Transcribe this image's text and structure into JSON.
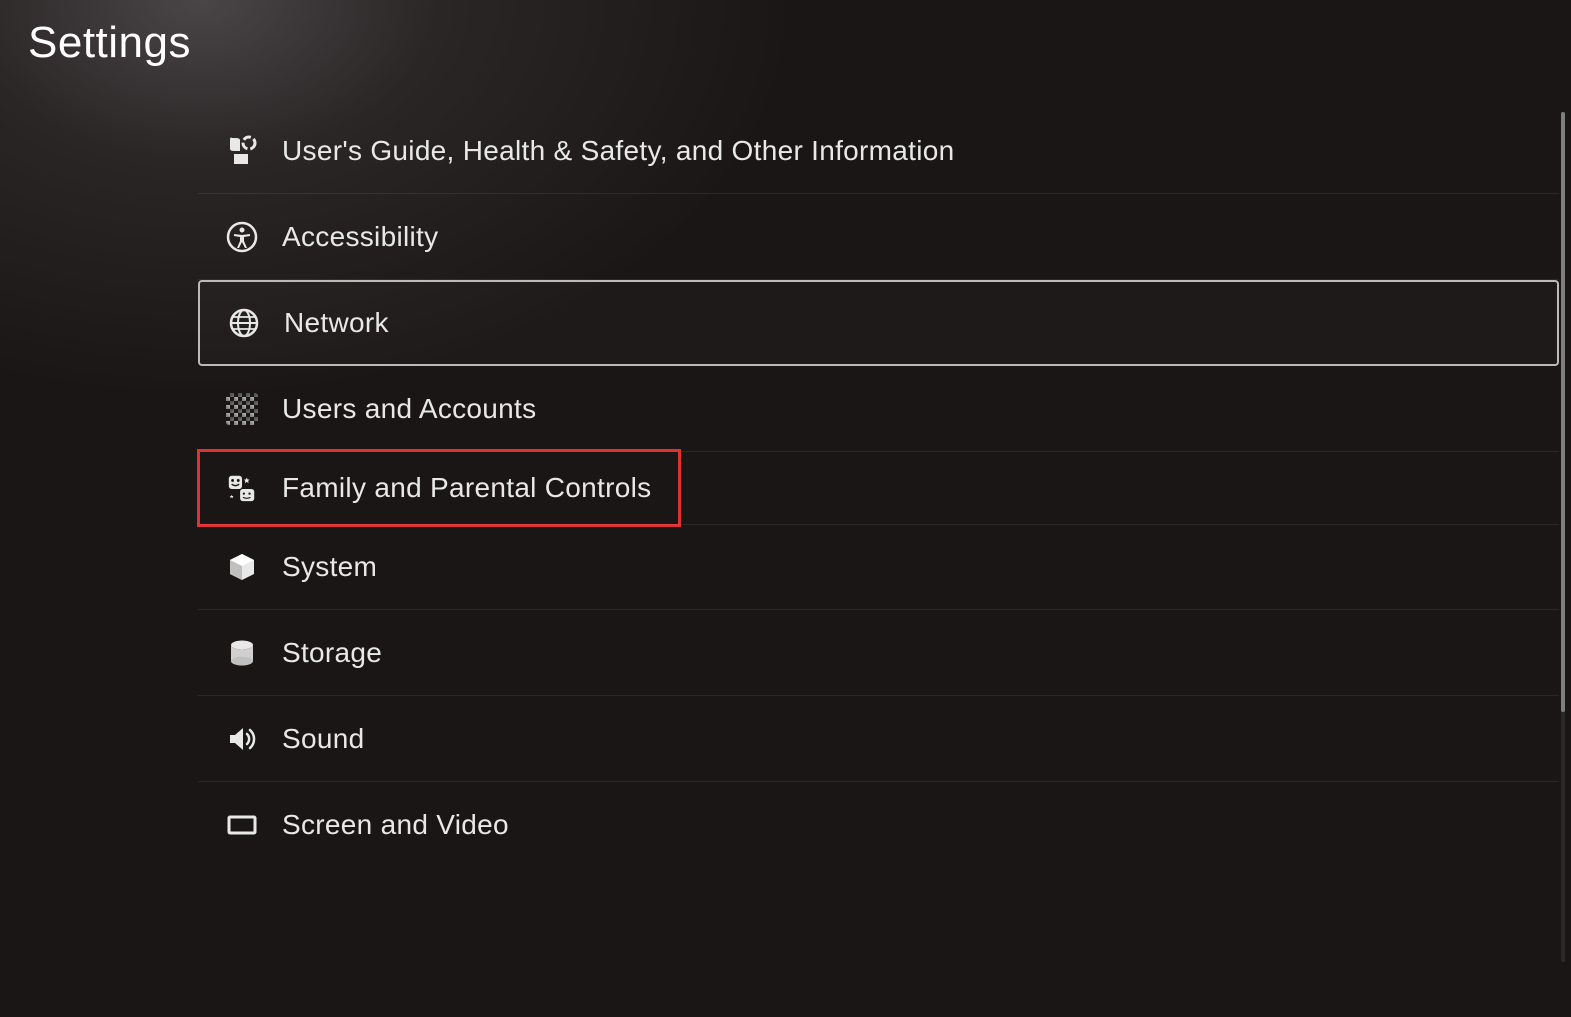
{
  "title": "Settings",
  "items": [
    {
      "id": "guide",
      "label": "User's Guide, Health & Safety, and Other Information",
      "icon": "guide-icon",
      "selected": false,
      "highlighted": false
    },
    {
      "id": "accessibility",
      "label": "Accessibility",
      "icon": "accessibility-icon",
      "selected": false,
      "highlighted": false
    },
    {
      "id": "network",
      "label": "Network",
      "icon": "globe-icon",
      "selected": true,
      "highlighted": false
    },
    {
      "id": "users",
      "label": "Users and Accounts",
      "icon": "avatar-icon",
      "selected": false,
      "highlighted": false
    },
    {
      "id": "family",
      "label": "Family and Parental Controls",
      "icon": "family-icon",
      "selected": false,
      "highlighted": true
    },
    {
      "id": "system",
      "label": "System",
      "icon": "cube-icon",
      "selected": false,
      "highlighted": false
    },
    {
      "id": "storage",
      "label": "Storage",
      "icon": "storage-icon",
      "selected": false,
      "highlighted": false
    },
    {
      "id": "sound",
      "label": "Sound",
      "icon": "speaker-icon",
      "selected": false,
      "highlighted": false
    },
    {
      "id": "screen",
      "label": "Screen and Video",
      "icon": "screen-icon",
      "selected": false,
      "highlighted": false
    }
  ]
}
